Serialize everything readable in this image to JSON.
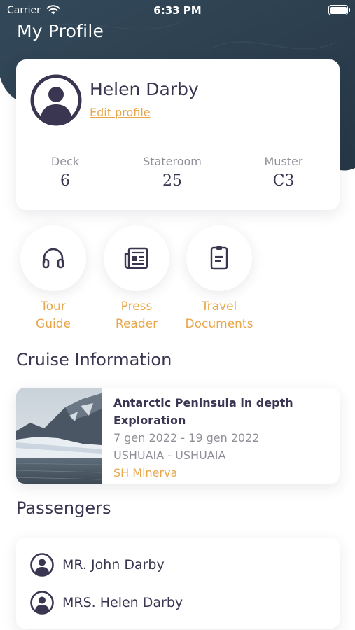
{
  "status_bar": {
    "carrier": "Carrier",
    "time": "6:33 PM"
  },
  "header": {
    "title": "My Profile"
  },
  "profile": {
    "name": "Helen Darby",
    "edit_label": "Edit profile",
    "stats": [
      {
        "label": "Deck",
        "value": "6"
      },
      {
        "label": "Stateroom",
        "value": "25"
      },
      {
        "label": "Muster",
        "value": "C3"
      }
    ]
  },
  "actions": [
    {
      "label": "Tour\nGuide",
      "icon": "headphones-icon"
    },
    {
      "label": "Press\nReader",
      "icon": "newspaper-icon"
    },
    {
      "label": "Travel\nDocuments",
      "icon": "document-icon"
    }
  ],
  "cruise": {
    "section_title": "Cruise Information",
    "title": "Antarctic Peninsula in depth Exploration",
    "dates": "7 gen 2022 - 19 gen 2022",
    "route": "USHUAIA - USHUAIA",
    "ship": "SH Minerva"
  },
  "passengers": {
    "section_title": "Passengers",
    "items": [
      {
        "name": "MR. John Darby"
      },
      {
        "name": "MRS. Helen Darby"
      }
    ]
  },
  "colors": {
    "accent": "#e8a64a",
    "header_bg": "#2e4050",
    "text": "#3a3550",
    "muted": "#8f8f98"
  }
}
